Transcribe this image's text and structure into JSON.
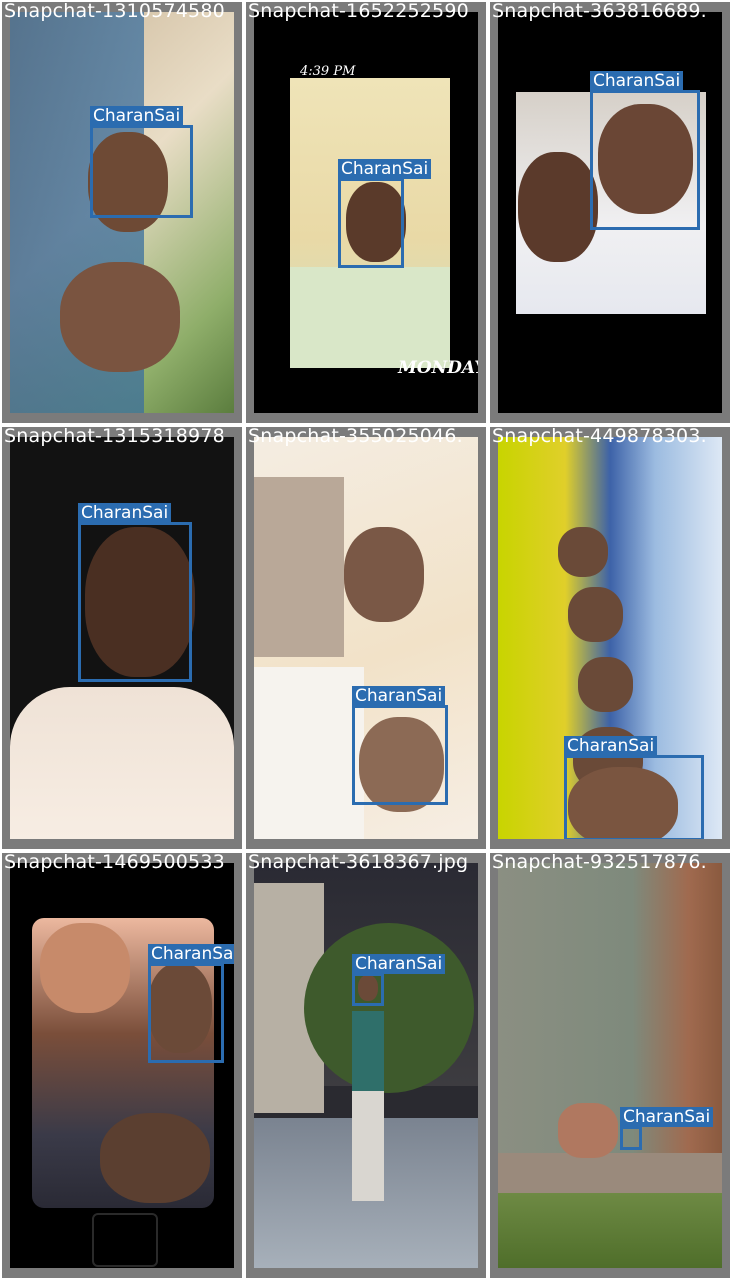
{
  "detections": [
    {
      "filename": "Snapchat-1310574580",
      "label": "CharanSai"
    },
    {
      "filename": "Snapchat-1652252590",
      "label": "CharanSai",
      "time_text": "4:39 PM",
      "sticker_text": "MONDAY"
    },
    {
      "filename": "Snapchat-363816689.",
      "label": "CharanSai"
    },
    {
      "filename": "Snapchat-1315318978",
      "label": "CharanSai"
    },
    {
      "filename": "Snapchat-355025046.",
      "label": "CharanSai"
    },
    {
      "filename": "Snapchat-449878303.",
      "label": "CharanSai"
    },
    {
      "filename": "Snapchat-1469500533",
      "label": "CharanSai"
    },
    {
      "filename": "Snapchat-3618367.jpg",
      "label": "CharanSai"
    },
    {
      "filename": "Snapchat-932517876.",
      "label": "CharanSai"
    }
  ],
  "colors": {
    "box": "#2b6cb0",
    "label_text": "#ffffff",
    "frame": "#7b7b7b"
  }
}
